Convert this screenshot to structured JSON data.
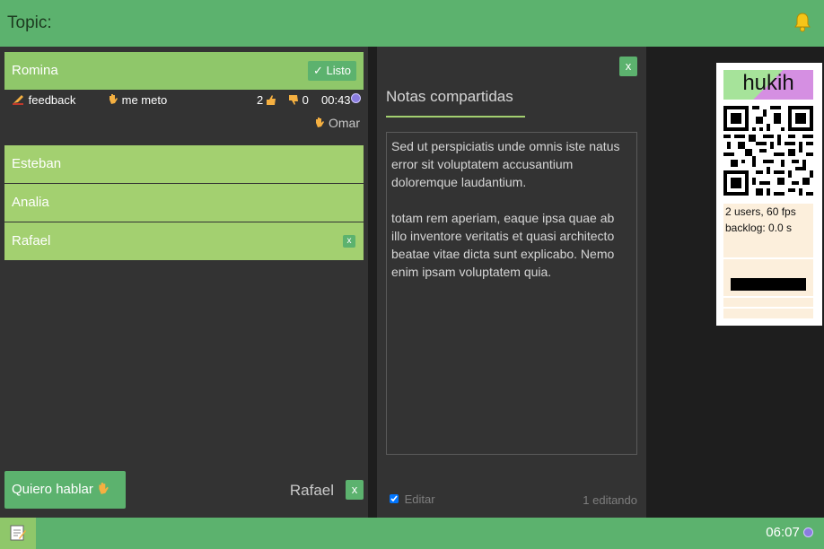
{
  "header": {
    "topic_label": "Topic:",
    "bell_icon": "bell-icon"
  },
  "queue": {
    "current": {
      "name": "Romina",
      "done_label": "✓ Listo",
      "feedback_label": "feedback",
      "me_meto_label": "me meto",
      "thumbs_up_count": "2",
      "thumbs_down_count": "0",
      "timer": "00:43",
      "owner": "Omar"
    },
    "others": [
      {
        "name": "Esteban"
      },
      {
        "name": "Analia"
      },
      {
        "name": "Rafael",
        "remove_label": "x"
      }
    ],
    "talk_button_label": "Quiero hablar",
    "speaker_name": "Rafael",
    "speaker_remove_label": "x"
  },
  "notes": {
    "close_label": "x",
    "title": "Notas compartidas",
    "body": "Sed ut perspiciatis unde omnis iste natus error sit voluptatem accusantium doloremque laudantium.\n\ntotam rem aperiam, eaque ipsa quae ab illo inventore veritatis et quasi architecto beatae vitae dicta sunt explicabo. Nemo enim ipsam voluptatem quia.",
    "edit_label": "Editar",
    "edit_checked": true,
    "editing_count": "1 editando"
  },
  "session_card": {
    "name": "hukih",
    "stats_line_1": "2 users, 60 fps",
    "stats_line_2": "backlog: 0.0 s"
  },
  "footer": {
    "clock": "06:07"
  },
  "colors": {
    "accent": "#5cb26e",
    "person_bg": "#a3d070",
    "panel_bg": "#333333",
    "status_dot": "#8a7ce0"
  }
}
